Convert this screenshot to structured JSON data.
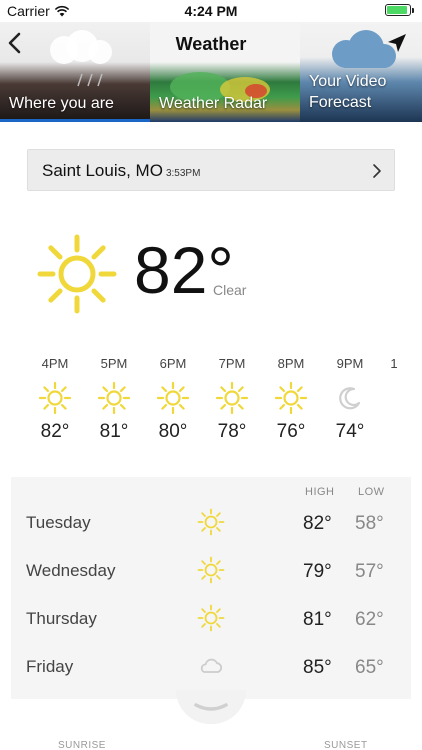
{
  "status_bar": {
    "carrier": "Carrier",
    "time": "4:24 PM",
    "battery_level": 0.9,
    "battery_color": "#4cd964"
  },
  "header": {
    "title": "Weather",
    "back_icon": "chevron-left-icon",
    "location_icon": "location-arrow-icon"
  },
  "tabs": [
    {
      "label": "Where you are",
      "active": true
    },
    {
      "label": "Weather Radar",
      "active": false
    },
    {
      "label_line1": "Your Video",
      "label_line2": "Forecast",
      "active": false
    }
  ],
  "accent_color": "#1a66c7",
  "location": {
    "city": "Saint Louis, MO",
    "time": "3:53PM"
  },
  "current": {
    "temp": "82°",
    "condition": "Clear",
    "icon": "sun-icon",
    "icon_color": "#f0d83a"
  },
  "hourly": [
    {
      "time": "4PM",
      "temp": "82°",
      "icon": "sun-icon"
    },
    {
      "time": "5PM",
      "temp": "81°",
      "icon": "sun-icon"
    },
    {
      "time": "6PM",
      "temp": "80°",
      "icon": "sun-icon"
    },
    {
      "time": "7PM",
      "temp": "78°",
      "icon": "sun-icon"
    },
    {
      "time": "8PM",
      "temp": "76°",
      "icon": "sun-icon"
    },
    {
      "time": "9PM",
      "temp": "74°",
      "icon": "moon-icon"
    },
    {
      "time": "1",
      "temp": "",
      "icon": ""
    }
  ],
  "daily": {
    "high_label": "HIGH",
    "low_label": "LOW",
    "days": [
      {
        "name": "Tuesday",
        "high": "82°",
        "low": "58°",
        "icon": "sun-icon"
      },
      {
        "name": "Wednesday",
        "high": "79°",
        "low": "57°",
        "icon": "sun-icon"
      },
      {
        "name": "Thursday",
        "high": "81°",
        "low": "62°",
        "icon": "sun-icon"
      },
      {
        "name": "Friday",
        "high": "85°",
        "low": "65°",
        "icon": "cloud-icon"
      }
    ]
  },
  "footer": {
    "sunrise_label": "SUNRISE",
    "sunset_label": "SUNSET"
  }
}
